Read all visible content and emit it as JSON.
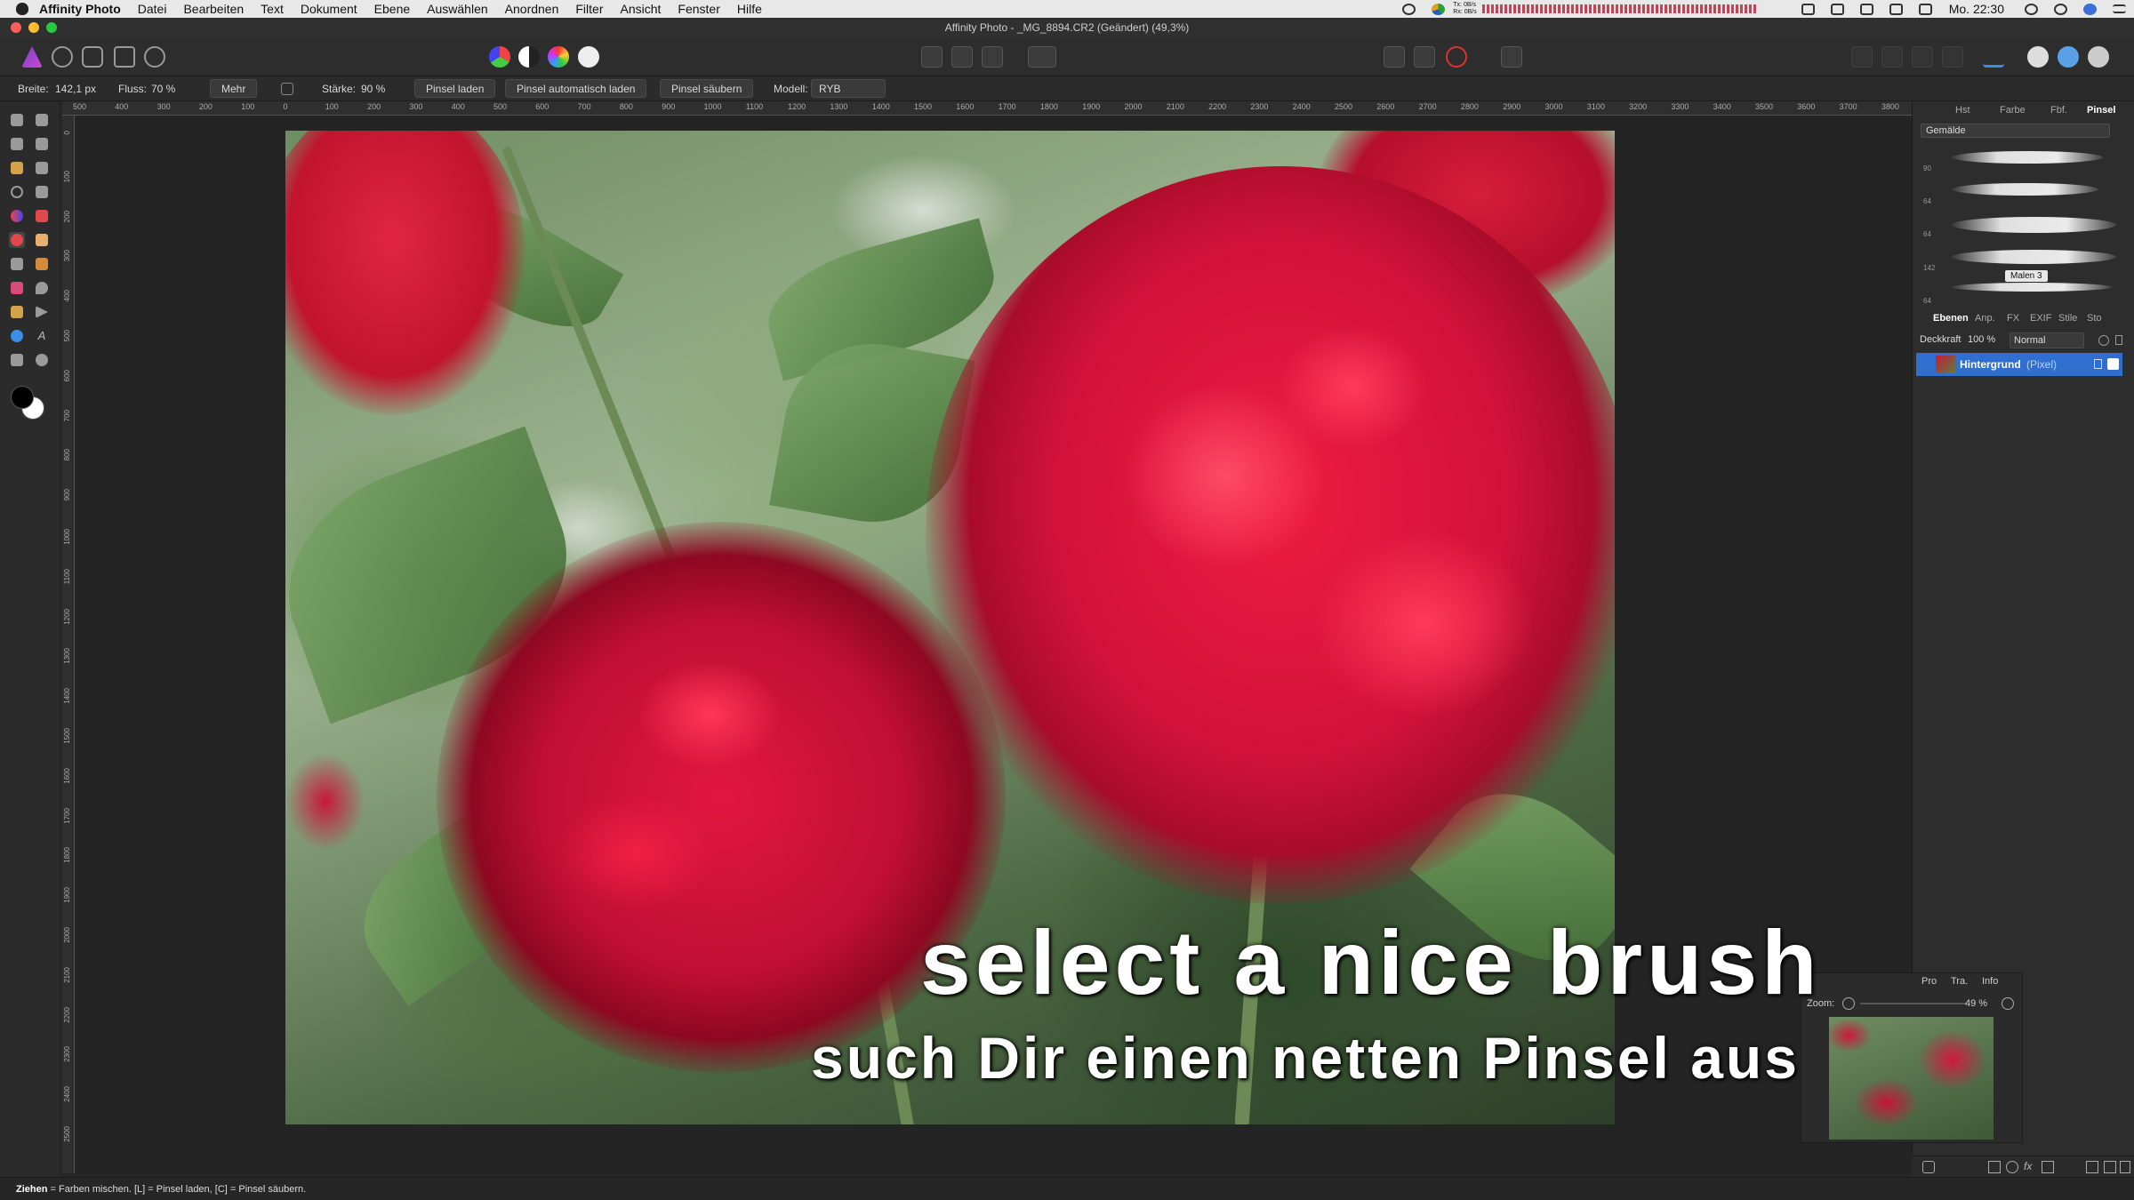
{
  "menubar": {
    "app_name": "Affinity Photo",
    "items": [
      "Datei",
      "Bearbeiten",
      "Text",
      "Dokument",
      "Ebene",
      "Auswählen",
      "Anordnen",
      "Filter",
      "Ansicht",
      "Fenster",
      "Hilfe"
    ],
    "clock": "Mo. 22:30",
    "net_tx": "Tx: 0B/s",
    "net_rx": "Rx: 0B/s"
  },
  "window": {
    "title": "Affinity Photo - _MG_8894.CR2 (Geändert) (49,3%)"
  },
  "context_toolbar": {
    "width_label": "Breite:",
    "width_value": "142,1 px",
    "flow_label": "Fluss:",
    "flow_value": "70 %",
    "more_button": "Mehr",
    "strength_label": "Stärke:",
    "strength_value": "90 %",
    "load_brush": "Pinsel laden",
    "auto_load": "Pinsel automatisch laden",
    "clean_brush": "Pinsel säubern",
    "model_label": "Modell:",
    "model_value": "RYB"
  },
  "ruler": {
    "top_ticks": [
      "500",
      "400",
      "300",
      "200",
      "100",
      "0",
      "100",
      "200",
      "300",
      "400",
      "500",
      "600",
      "700",
      "800",
      "900",
      "1000",
      "1100",
      "1200",
      "1300",
      "1400",
      "1500",
      "1600",
      "1700",
      "1800",
      "1900",
      "2000",
      "2100",
      "2200",
      "2300",
      "2400",
      "2500",
      "2600",
      "2700",
      "2800",
      "2900",
      "3000",
      "3100",
      "3200",
      "3300",
      "3400",
      "3500",
      "3600",
      "3700",
      "3800"
    ],
    "left_ticks": [
      "0",
      "100",
      "200",
      "300",
      "400",
      "500",
      "600",
      "700",
      "800",
      "900",
      "1000",
      "1100",
      "1200",
      "1300",
      "1400",
      "1500",
      "1600",
      "1700",
      "1800",
      "1900",
      "2000",
      "2100",
      "2200",
      "2300",
      "2400",
      "2500"
    ]
  },
  "brush_panel": {
    "tabs": [
      "Hst",
      "Farbe",
      "Fbf.",
      "Pinsel"
    ],
    "active_tab": "Pinsel",
    "category": "Gemälde",
    "brush_sizes": [
      "90",
      "64",
      "64",
      "142",
      "64"
    ],
    "tooltip": "Malen 3"
  },
  "layers_panel": {
    "tabs": [
      "Ebenen",
      "Anp.",
      "FX",
      "EXIF",
      "Stile",
      "Sto"
    ],
    "active_tab": "Ebenen",
    "opacity_label": "Deckkraft",
    "opacity_value": "100 %",
    "blend_mode": "Normal",
    "layer_name": "Hintergrund",
    "layer_type": "(Pixel)"
  },
  "navigator_panel": {
    "tabs": [
      "Pro",
      "Tra.",
      "Info"
    ],
    "zoom_label": "Zoom:",
    "zoom_value": "49 %"
  },
  "subtitles": {
    "line1": "select a nice brush",
    "line2": "such Dir einen netten Pinsel aus"
  },
  "statusbar": {
    "bold": "Ziehen",
    "text": " = Farben mischen. [L] = Pinsel laden, [C] = Pinsel säubern."
  }
}
